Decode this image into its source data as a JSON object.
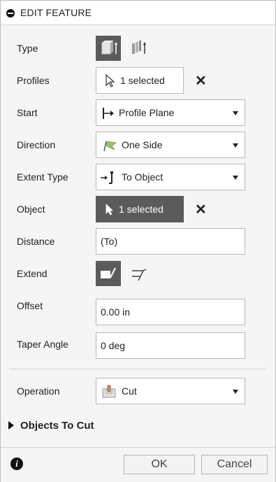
{
  "header": {
    "title": "EDIT FEATURE"
  },
  "fields": {
    "type": {
      "label": "Type"
    },
    "profiles": {
      "label": "Profiles",
      "value": "1 selected"
    },
    "start": {
      "label": "Start",
      "value": "Profile Plane"
    },
    "direction": {
      "label": "Direction",
      "value": "One Side"
    },
    "extent_type": {
      "label": "Extent Type",
      "value": "To Object"
    },
    "object": {
      "label": "Object",
      "value": "1 selected"
    },
    "distance": {
      "label": "Distance",
      "value": "(To)"
    },
    "extend": {
      "label": "Extend"
    },
    "offset": {
      "label": "Offset",
      "value": "0.00 in"
    },
    "taper_angle": {
      "label": "Taper Angle",
      "value": "0 deg"
    },
    "operation": {
      "label": "Operation",
      "value": "Cut"
    }
  },
  "section": {
    "objects_to_cut": "Objects To Cut"
  },
  "footer": {
    "ok_label": "OK",
    "cancel_label": "Cancel"
  },
  "colors": {
    "active_button": "#5b5b5b",
    "accent_green": "#6a9a2a"
  }
}
